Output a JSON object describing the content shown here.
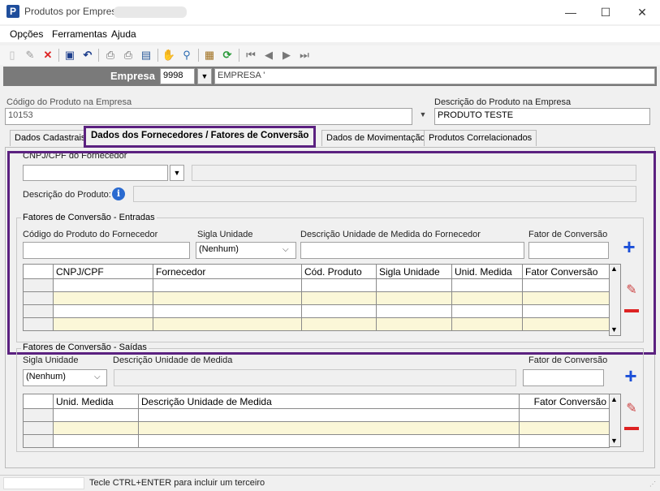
{
  "window": {
    "title": "Produtos por Empresa",
    "minimize": "—",
    "maximize": "☐",
    "close": "✕"
  },
  "menu": [
    "Opções",
    "Ferramentas",
    "Ajuda"
  ],
  "empresa": {
    "label": "Empresa",
    "code": "9998",
    "name": "EMPRESA '"
  },
  "produto": {
    "code_label": "Código do Produto na Empresa",
    "code_value": "10153",
    "desc_label": "Descrição do Produto na Empresa",
    "desc_value": "PRODUTO TESTE"
  },
  "tabs": [
    "Dados Cadastrais",
    "Dados dos Fornecedores / Fatores de Conversão",
    "Dados de Movimentação",
    "Produtos Correlacionados"
  ],
  "fornecedor": {
    "cnpj_label": "CNPJ/CPF do Fornecedor",
    "desc_label": "Descrição do Produto:"
  },
  "entradas": {
    "title": "Fatores de Conversão - Entradas",
    "cod_label": "Código do Produto do Fornecedor",
    "sigla_label": "Sigla Unidade",
    "sigla_value": "(Nenhum)",
    "desc_label": "Descrição Unidade de Medida do Fornecedor",
    "fator_label": "Fator de Conversão",
    "columns": [
      "CNPJ/CPF",
      "Fornecedor",
      "Cód. Produto",
      "Sigla Unidade",
      "Unid. Medida",
      "Fator Conversão"
    ]
  },
  "saidas": {
    "title": "Fatores de Conversão - Saídas",
    "sigla_label": "Sigla Unidade",
    "sigla_value": "(Nenhum)",
    "desc_label": "Descrição Unidade de Medida",
    "fator_label": "Fator de Conversão",
    "columns": [
      "Unid. Medida",
      "Descrição Unidade de Medida",
      "Fator Conversão"
    ]
  },
  "status": {
    "message": "Tecle CTRL+ENTER para incluir um terceiro"
  }
}
